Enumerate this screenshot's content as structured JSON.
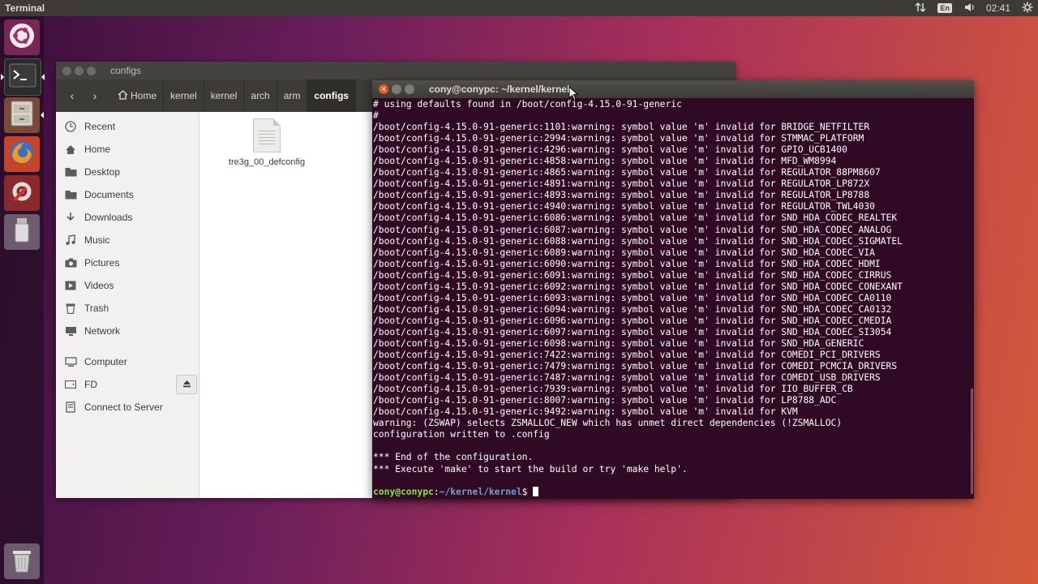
{
  "top_panel": {
    "title": "Terminal",
    "lang": "En",
    "time": "02:41"
  },
  "launcher": {
    "items": [
      {
        "name": "ubuntu-dash",
        "icon": "ubuntu-logo-icon"
      },
      {
        "name": "terminal",
        "icon": "terminal-icon"
      },
      {
        "name": "files",
        "icon": "file-cabinet-icon"
      },
      {
        "name": "firefox",
        "icon": "firefox-icon"
      },
      {
        "name": "system-settings",
        "icon": "settings-icon"
      },
      {
        "name": "usb-drive",
        "icon": "usb-drive-icon"
      },
      {
        "name": "trash",
        "icon": "trash-icon"
      }
    ]
  },
  "file_manager": {
    "title": "configs",
    "breadcrumbs": [
      "Home",
      "kernel",
      "kernel",
      "arch",
      "arm",
      "configs"
    ],
    "sidebar": {
      "places": [
        {
          "label": "Recent",
          "icon": "clock-icon"
        },
        {
          "label": "Home",
          "icon": "home-icon"
        },
        {
          "label": "Desktop",
          "icon": "folder-icon"
        },
        {
          "label": "Documents",
          "icon": "folder-icon"
        },
        {
          "label": "Downloads",
          "icon": "download-icon"
        },
        {
          "label": "Music",
          "icon": "music-icon"
        },
        {
          "label": "Pictures",
          "icon": "camera-icon"
        },
        {
          "label": "Videos",
          "icon": "film-icon"
        },
        {
          "label": "Trash",
          "icon": "trash-icon"
        },
        {
          "label": "Network",
          "icon": "network-icon"
        }
      ],
      "devices": [
        {
          "label": "Computer",
          "icon": "computer-icon"
        },
        {
          "label": "FD",
          "icon": "drive-icon"
        },
        {
          "label": "Connect to Server",
          "icon": "server-icon"
        }
      ]
    },
    "files": [
      {
        "name": "tre3g_00_defconfig",
        "icon": "text-document-icon"
      }
    ]
  },
  "terminal": {
    "title": "cony@conypc: ~/kernel/kernel",
    "lines": [
      "# using defaults found in /boot/config-4.15.0-91-generic",
      "#",
      "/boot/config-4.15.0-91-generic:1101:warning: symbol value 'm' invalid for BRIDGE_NETFILTER",
      "/boot/config-4.15.0-91-generic:2994:warning: symbol value 'm' invalid for STMMAC_PLATFORM",
      "/boot/config-4.15.0-91-generic:4296:warning: symbol value 'm' invalid for GPIO_UCB1400",
      "/boot/config-4.15.0-91-generic:4858:warning: symbol value 'm' invalid for MFD_WM8994",
      "/boot/config-4.15.0-91-generic:4865:warning: symbol value 'm' invalid for REGULATOR_88PM8607",
      "/boot/config-4.15.0-91-generic:4891:warning: symbol value 'm' invalid for REGULATOR_LP872X",
      "/boot/config-4.15.0-91-generic:4893:warning: symbol value 'm' invalid for REGULATOR_LP8788",
      "/boot/config-4.15.0-91-generic:4940:warning: symbol value 'm' invalid for REGULATOR_TWL4030",
      "/boot/config-4.15.0-91-generic:6086:warning: symbol value 'm' invalid for SND_HDA_CODEC_REALTEK",
      "/boot/config-4.15.0-91-generic:6087:warning: symbol value 'm' invalid for SND_HDA_CODEC_ANALOG",
      "/boot/config-4.15.0-91-generic:6088:warning: symbol value 'm' invalid for SND_HDA_CODEC_SIGMATEL",
      "/boot/config-4.15.0-91-generic:6089:warning: symbol value 'm' invalid for SND_HDA_CODEC_VIA",
      "/boot/config-4.15.0-91-generic:6090:warning: symbol value 'm' invalid for SND_HDA_CODEC_HDMI",
      "/boot/config-4.15.0-91-generic:6091:warning: symbol value 'm' invalid for SND_HDA_CODEC_CIRRUS",
      "/boot/config-4.15.0-91-generic:6092:warning: symbol value 'm' invalid for SND_HDA_CODEC_CONEXANT",
      "/boot/config-4.15.0-91-generic:6093:warning: symbol value 'm' invalid for SND_HDA_CODEC_CA0110",
      "/boot/config-4.15.0-91-generic:6094:warning: symbol value 'm' invalid for SND_HDA_CODEC_CA0132",
      "/boot/config-4.15.0-91-generic:6096:warning: symbol value 'm' invalid for SND_HDA_CODEC_CMEDIA",
      "/boot/config-4.15.0-91-generic:6097:warning: symbol value 'm' invalid for SND_HDA_CODEC_SI3054",
      "/boot/config-4.15.0-91-generic:6098:warning: symbol value 'm' invalid for SND_HDA_GENERIC",
      "/boot/config-4.15.0-91-generic:7422:warning: symbol value 'm' invalid for COMEDI_PCI_DRIVERS",
      "/boot/config-4.15.0-91-generic:7479:warning: symbol value 'm' invalid for COMEDI_PCMCIA_DRIVERS",
      "/boot/config-4.15.0-91-generic:7487:warning: symbol value 'm' invalid for COMEDI_USB_DRIVERS",
      "/boot/config-4.15.0-91-generic:7939:warning: symbol value 'm' invalid for IIO_BUFFER_CB",
      "/boot/config-4.15.0-91-generic:8007:warning: symbol value 'm' invalid for LP8788_ADC",
      "/boot/config-4.15.0-91-generic:9492:warning: symbol value 'm' invalid for KVM",
      "warning: (ZSWAP) selects ZSMALLOC_NEW which has unmet direct dependencies (!ZSMALLOC)",
      "configuration written to .config",
      "",
      "*** End of the configuration.",
      "*** Execute 'make' to start the build or try 'make help'.",
      ""
    ],
    "prompt": {
      "user_host": "cony@conypc",
      "sep": ":",
      "path": "~/kernel/kernel",
      "symbol": "$ "
    }
  },
  "colors": {
    "terminal_bg": "#300a24",
    "prompt_user": "#8ae234",
    "prompt_path": "#729fcf",
    "accent": "#e95420"
  }
}
